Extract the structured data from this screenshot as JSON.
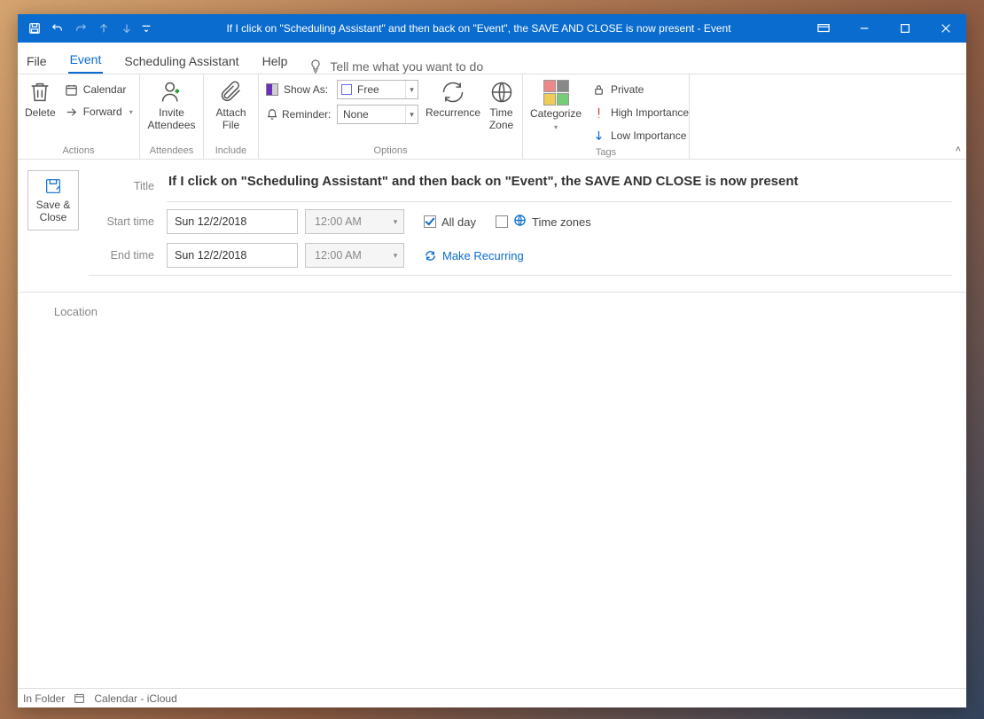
{
  "title": "If I click on \"Scheduling Assistant\" and then back on \"Event\", the SAVE AND CLOSE is now present  -  Event",
  "tabs": {
    "file": "File",
    "event": "Event",
    "scheduling": "Scheduling Assistant",
    "help": "Help",
    "tellme": "Tell me what you want to do"
  },
  "ribbon": {
    "actions": {
      "label": "Actions",
      "delete": "Delete",
      "calendar": "Calendar",
      "forward": "Forward"
    },
    "attendees": {
      "label": "Attendees",
      "invite": "Invite Attendees"
    },
    "include": {
      "label": "Include",
      "attach": "Attach File"
    },
    "options": {
      "label": "Options",
      "showas_label": "Show As:",
      "showas_value": "Free",
      "reminder_label": "Reminder:",
      "reminder_value": "None",
      "recurrence": "Recurrence",
      "timezone": "Time Zone"
    },
    "tags": {
      "label": "Tags",
      "categorize": "Categorize",
      "private": "Private",
      "high": "High Importance",
      "low": "Low Importance"
    }
  },
  "form": {
    "saveclose": "Save & Close",
    "title_label": "Title",
    "title_value": "If I click on \"Scheduling Assistant\" and then back on \"Event\", the SAVE AND CLOSE is now present",
    "start_label": "Start time",
    "start_date": "Sun 12/2/2018",
    "start_time": "12:00 AM",
    "end_label": "End time",
    "end_date": "Sun 12/2/2018",
    "end_time": "12:00 AM",
    "allday": "All day",
    "timezones": "Time zones",
    "recurring": "Make Recurring",
    "location_label": "Location"
  },
  "status": {
    "infolder": "In Folder",
    "calendar": "Calendar - iCloud"
  }
}
